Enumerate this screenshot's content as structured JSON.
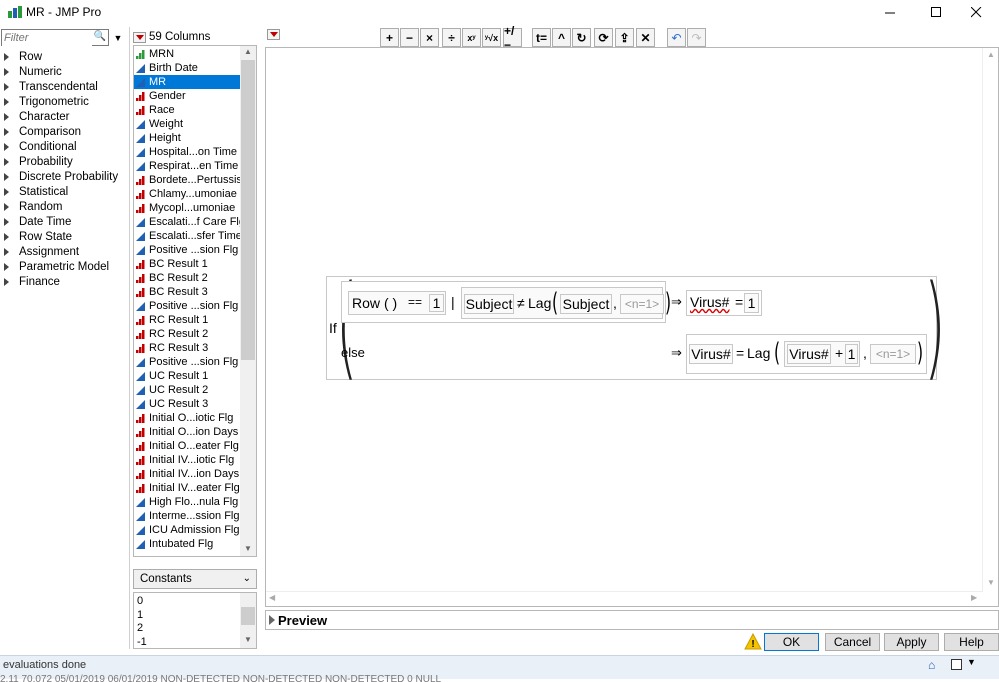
{
  "window": {
    "title": "MR - JMP Pro"
  },
  "filter": {
    "placeholder": "Filter"
  },
  "functions": [
    "Row",
    "Numeric",
    "Transcendental",
    "Trigonometric",
    "Character",
    "Comparison",
    "Conditional",
    "Probability",
    "Discrete Probability",
    "Statistical",
    "Random",
    "Date Time",
    "Row State",
    "Assignment",
    "Parametric Model",
    "Finance"
  ],
  "columns": {
    "count_label": "59 Columns",
    "items": [
      {
        "name": "MRN",
        "type": "nominal"
      },
      {
        "name": "Birth Date",
        "type": "continuous"
      },
      {
        "name": "MR",
        "type": "continuous",
        "selected": true
      },
      {
        "name": "Gender",
        "type": "nominal-red"
      },
      {
        "name": "Race",
        "type": "nominal-red"
      },
      {
        "name": "Weight",
        "type": "continuous"
      },
      {
        "name": "Height",
        "type": "continuous"
      },
      {
        "name": "Hospital...on Time",
        "type": "continuous"
      },
      {
        "name": "Respirat...en Time",
        "type": "continuous"
      },
      {
        "name": "Bordete...Pertussis",
        "type": "nominal-red"
      },
      {
        "name": "Chlamy...umoniae",
        "type": "nominal-red"
      },
      {
        "name": "Mycopl...umoniae",
        "type": "nominal-red"
      },
      {
        "name": "Escalati...f Care Flg",
        "type": "continuous"
      },
      {
        "name": "Escalati...sfer Time",
        "type": "continuous"
      },
      {
        "name": "Positive ...sion Flg",
        "type": "continuous"
      },
      {
        "name": "BC Result 1",
        "type": "nominal-red"
      },
      {
        "name": "BC Result 2",
        "type": "nominal-red"
      },
      {
        "name": "BC Result 3",
        "type": "nominal-red"
      },
      {
        "name": "Positive ...sion Flg",
        "type": "continuous"
      },
      {
        "name": "RC Result 1",
        "type": "nominal-red"
      },
      {
        "name": "RC Result 2",
        "type": "nominal-red"
      },
      {
        "name": "RC Result 3",
        "type": "nominal-red"
      },
      {
        "name": "Positive ...sion Flg",
        "type": "continuous"
      },
      {
        "name": "UC Result 1",
        "type": "continuous"
      },
      {
        "name": "UC Result 2",
        "type": "continuous"
      },
      {
        "name": "UC Result 3",
        "type": "continuous"
      },
      {
        "name": "Initial O...iotic Flg",
        "type": "nominal-red"
      },
      {
        "name": "Initial O...ion Days",
        "type": "nominal-red"
      },
      {
        "name": "Initial O...eater Flg",
        "type": "nominal-red"
      },
      {
        "name": "Initial IV...iotic Flg",
        "type": "nominal-red"
      },
      {
        "name": "Initial IV...ion Days",
        "type": "nominal-red"
      },
      {
        "name": "Initial IV...eater Flg",
        "type": "nominal-red"
      },
      {
        "name": "High Flo...nula Flg",
        "type": "continuous"
      },
      {
        "name": "Interme...ssion Flg",
        "type": "continuous"
      },
      {
        "name": "ICU Admission Flg",
        "type": "continuous"
      },
      {
        "name": "Intubated Flg",
        "type": "continuous"
      }
    ]
  },
  "constants": {
    "label": "Constants",
    "items": [
      "0",
      "1",
      "2",
      "-1"
    ]
  },
  "toolbar": {
    "buttons": [
      "+",
      "−",
      "×",
      "÷",
      "xʸ",
      "ʸ√x",
      "+/−",
      "t=",
      "^",
      "↻",
      "⟳",
      "⇪",
      "✕",
      "↶",
      "↷"
    ]
  },
  "formula": {
    "if": "If",
    "else": "else",
    "row": "Row",
    "row_parens": "( )",
    "eq": "==",
    "one": "1",
    "or": "|",
    "subject": "Subject",
    "neq": "≠",
    "lag": "Lag",
    "comma": ",",
    "n1": "<n=1>",
    "arrow": "⇒",
    "virus": "Virus#",
    "assign": "=",
    "plus": "+"
  },
  "preview": {
    "label": "Preview"
  },
  "buttons": {
    "ok": "OK",
    "cancel": "Cancel",
    "apply": "Apply",
    "help": "Help"
  },
  "status": {
    "text": "evaluations done",
    "row": "2.11  70.072          05/01/2019          06/01/2019    NON-DETECTED          NON-DETECTED          NON-DETECTED                                        0   NULL"
  },
  "colors": {
    "selection": "#0078d7",
    "continuous": "#1f5fb4",
    "nominal": "#2a9a3a",
    "nominal_red": "#c00000"
  }
}
